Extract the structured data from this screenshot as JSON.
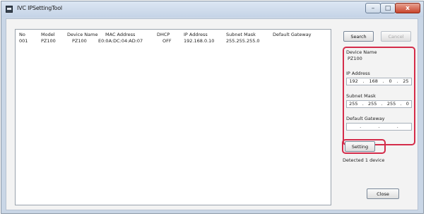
{
  "window": {
    "title": "IVC IPSettingTool",
    "controls": [
      "–",
      "□",
      "x"
    ]
  },
  "list": {
    "columns": [
      "No",
      "Model",
      "Device Name",
      "MAC Address",
      "DHCP",
      "IP Address",
      "Subnet Mask",
      "Default Gateway"
    ],
    "rows": [
      [
        "001",
        "PZ100",
        "PZ100",
        "E0:0A:DC:04:AD:07",
        "OFF",
        "192.168.0.10",
        "255.255.255.0",
        ""
      ]
    ]
  },
  "buttons": {
    "search": "Search",
    "cancel": "Cancel",
    "setting": "Setting",
    "close": "Close"
  },
  "panel": {
    "device_name_label": "Device Name",
    "device_name_value": "PZ100",
    "ip_label": "IP Address",
    "ip_octets": [
      "192",
      "168",
      "0",
      "25"
    ],
    "subnet_label": "Subnet Mask",
    "subnet_octets": [
      "255",
      "255",
      "255",
      "0"
    ],
    "gateway_label": "Default Gateway",
    "gateway_octets": [
      "",
      "",
      "",
      ""
    ]
  },
  "status": "Detected 1 device",
  "colors": {
    "highlight": "#d42c4a",
    "titlebar": "#c9d6e6"
  }
}
